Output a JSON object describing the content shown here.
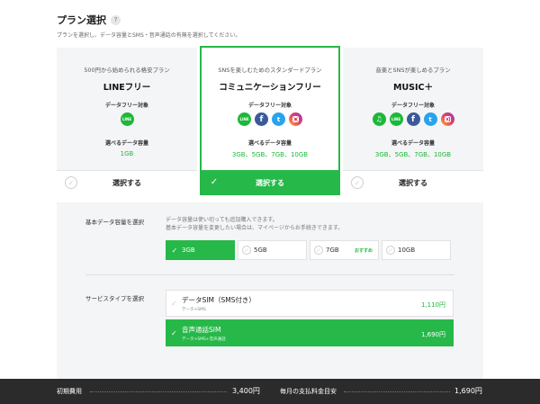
{
  "header": {
    "title": "プラン選択",
    "help": "?",
    "subtitle": "プランを選択し、データ容量とSMS・音声通話の有無を選択してください。"
  },
  "plans": [
    {
      "tag": "500円から始められる格安プラン",
      "name": "LINEフリー",
      "free_label": "データフリー対象",
      "icons": [
        "line-icon"
      ],
      "select_label": "選べるデータ容量",
      "capacities": "1GB",
      "button": "選択する",
      "selected": false
    },
    {
      "tag": "SNSを楽しむためのスタンダードプラン",
      "name": "コミュニケーションフリー",
      "free_label": "データフリー対象",
      "icons": [
        "line-icon",
        "facebook-icon",
        "twitter-icon",
        "instagram-icon"
      ],
      "select_label": "選べるデータ容量",
      "capacities": "3GB、5GB、7GB、10GB",
      "button": "選択する",
      "selected": true
    },
    {
      "tag": "音楽とSNSが楽しめるプラン",
      "name": "MUSIC＋",
      "free_label": "データフリー対象",
      "icons": [
        "line-music-icon",
        "line-icon",
        "facebook-icon",
        "twitter-icon",
        "instagram-icon"
      ],
      "select_label": "選べるデータ容量",
      "capacities": "3GB、5GB、7GB、10GB",
      "button": "選択する",
      "selected": false
    }
  ],
  "icon_glyphs": {
    "line": "LINE",
    "facebook": "f",
    "twitter": "t",
    "music": "♫",
    "check": "✓"
  },
  "data_capacity": {
    "label": "基本データ容量を選択",
    "note_line1": "データ容量は使い切っても追加購入できます。",
    "note_line2": "基本データ容量を変更したい場合は、マイページからお手続きできます。",
    "options": [
      {
        "label": "3GB",
        "selected": true,
        "badge": ""
      },
      {
        "label": "5GB",
        "selected": false,
        "badge": ""
      },
      {
        "label": "7GB",
        "selected": false,
        "badge": "おすすめ"
      },
      {
        "label": "10GB",
        "selected": false,
        "badge": ""
      }
    ]
  },
  "service_type": {
    "label": "サービスタイプを選択",
    "options": [
      {
        "name": "データSIM（SMS付き）",
        "desc": "データ+SMS",
        "price": "1,110円",
        "selected": false
      },
      {
        "name": "音声通話SIM",
        "desc": "データ+SMS+音声通話",
        "price": "1,690円",
        "selected": true
      }
    ]
  },
  "footer": {
    "initial_label": "初期費用",
    "initial_value": "3,400円",
    "monthly_label": "毎月の支払料金目安",
    "monthly_value": "1,690円"
  },
  "colors": {
    "accent": "#27b84a",
    "footer_bg": "#2b2b2b",
    "panel_bg": "#f4f5f6"
  }
}
